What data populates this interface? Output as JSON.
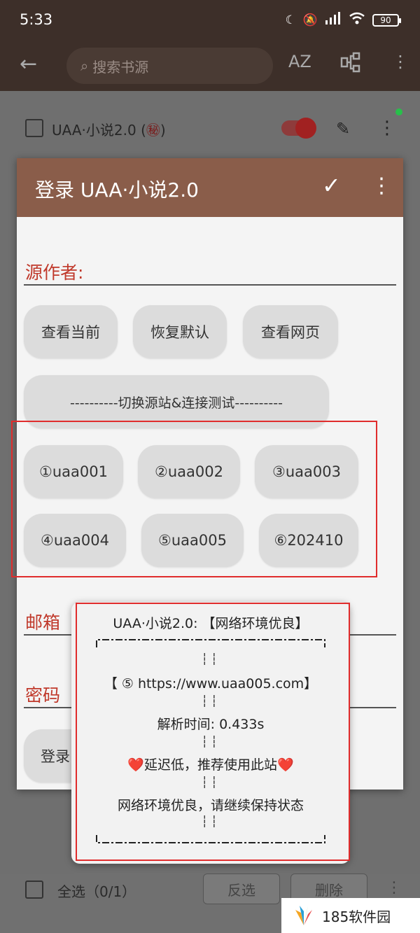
{
  "status": {
    "time": "5:33",
    "battery": "90"
  },
  "appbar": {
    "search_placeholder": "搜索书源",
    "sort_label": "AZ"
  },
  "list_row": {
    "name": "UAA·小说2.0 (",
    "badge_glyph": "㊙",
    "name_end": ")"
  },
  "dialog": {
    "title": "登录 UAA·小说2.0",
    "fields": {
      "author_label": "源作者:",
      "email_label": "邮箱",
      "password_label": "密码"
    },
    "buttons": {
      "view_current": "查看当前",
      "restore_default": "恢复默认",
      "view_webpage": "查看网页",
      "switch_test": "----------切换源站&连接测试----------",
      "login": "登录"
    },
    "sites": [
      "①uaa001",
      "②uaa002",
      "③uaa003",
      "④uaa004",
      "⑤uaa005",
      "⑥202410"
    ]
  },
  "toast": {
    "title": "UAA·小说2.0: 【网络环境优良】",
    "url_line": "【 ⑤ https://www.uaa005.com】",
    "parse_time": "解析时间: 0.433s",
    "latency": "❤️延迟低，推荐使用此站❤️",
    "env": "网络环境优良，请继续保持状态"
  },
  "bottom_bar": {
    "select_all": "全选（0/1）",
    "invert": "反选",
    "delete": "删除"
  },
  "watermark": {
    "text": "185软件园"
  },
  "colors": {
    "header": "#8a5d4a",
    "label_red": "#c0392b",
    "highlight_red": "#e02c2c"
  }
}
